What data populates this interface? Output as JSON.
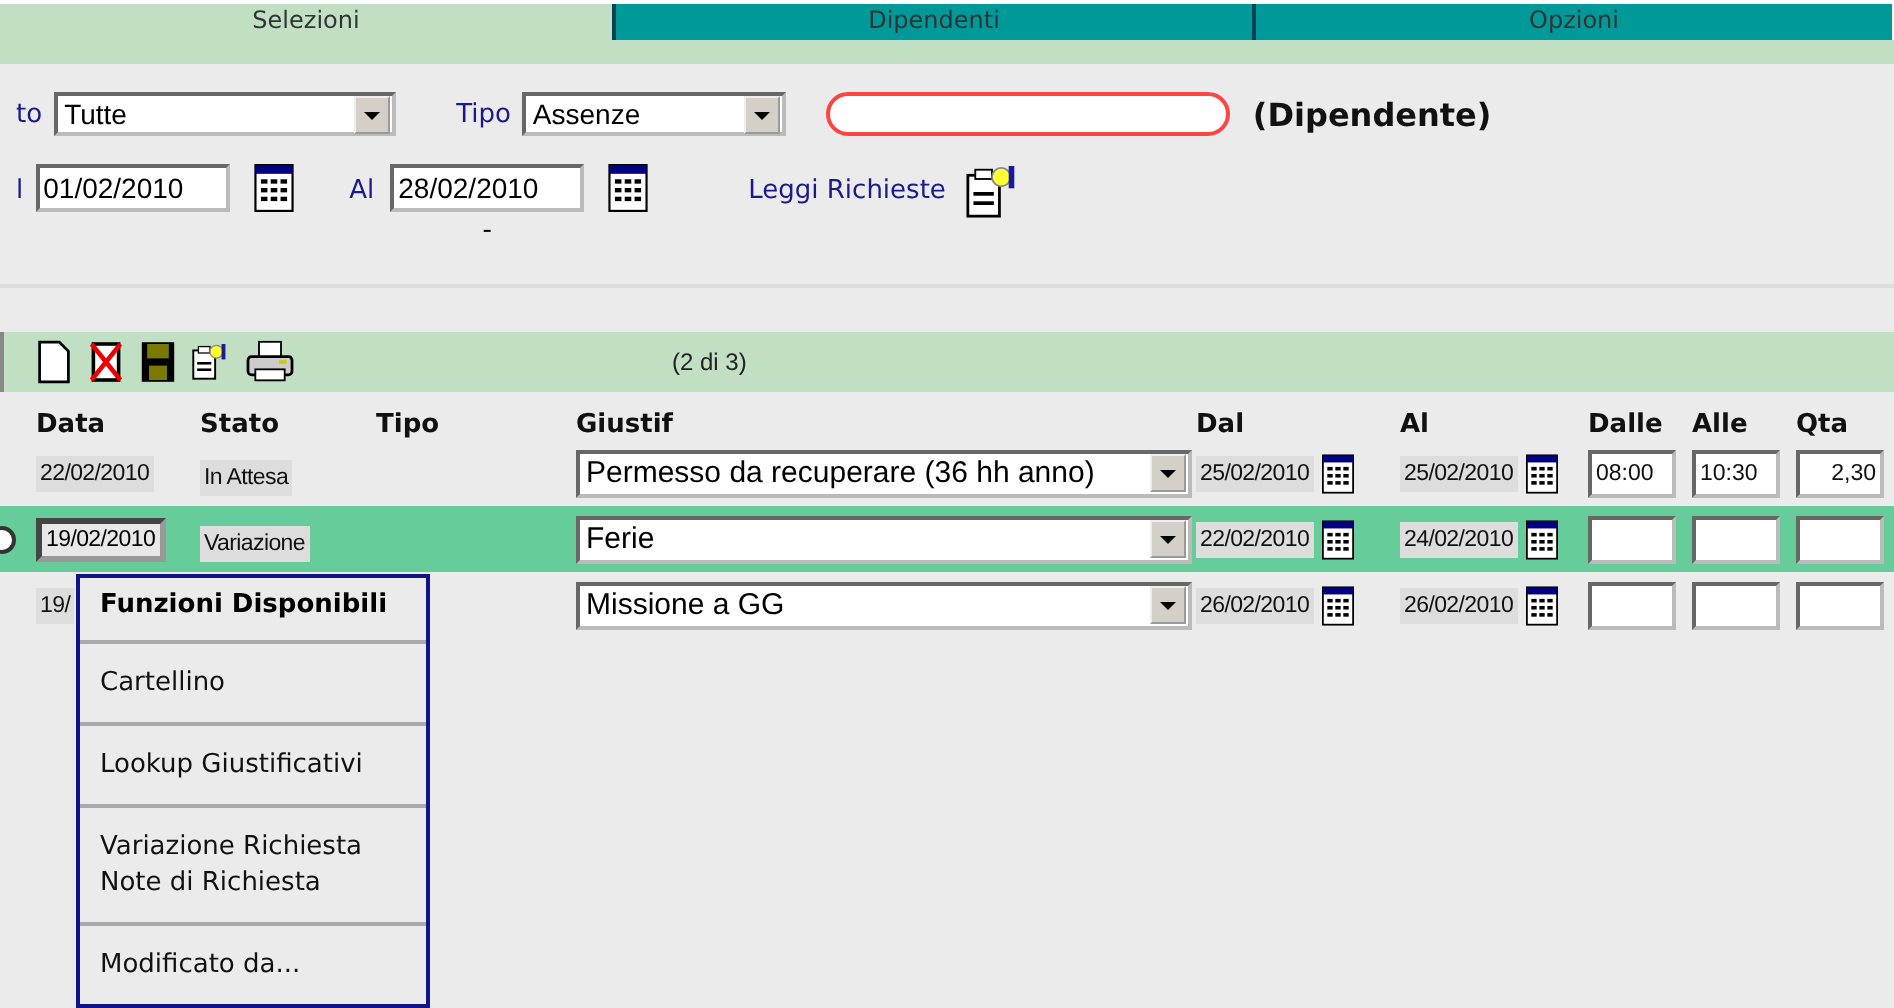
{
  "tabs": [
    {
      "label": "Selezioni",
      "selected": true
    },
    {
      "label": "Dipendenti",
      "selected": false
    },
    {
      "label": "Opzioni",
      "selected": false
    }
  ],
  "filters": {
    "stato_label": "to",
    "stato_value": "Tutte",
    "tipo_label": "Tipo",
    "tipo_value": "Assenze",
    "employee_label": "(Dipendente)",
    "dal_label": "l",
    "dal_value": "01/02/2010",
    "al_label": "Al",
    "al_value": "28/02/2010",
    "read_link": "Leggi Richieste",
    "dash": "-"
  },
  "toolbar": {
    "counter": "(2 di 3)"
  },
  "columns": [
    "Data",
    "Stato",
    "Tipo",
    "Giustif",
    "Dal",
    "Al",
    "Dalle",
    "Alle",
    "Qta"
  ],
  "rows": [
    {
      "selected": false,
      "data": "22/02/2010",
      "stato": "In Attesa",
      "giustif": "Permesso da recuperare (36 hh anno)",
      "dal": "25/02/2010",
      "al": "25/02/2010",
      "dalle": "08:00",
      "alle": "10:30",
      "qta": "2,30"
    },
    {
      "selected": true,
      "data": "19/02/2010",
      "stato": "Variazione",
      "giustif": "Ferie",
      "dal": "22/02/2010",
      "al": "24/02/2010"
    },
    {
      "selected": false,
      "data": "19/",
      "giustif": "Missione a GG",
      "dal": "26/02/2010",
      "al": "26/02/2010"
    }
  ],
  "context_menu": {
    "title": "Funzioni Disponibili",
    "items": [
      {
        "lines": [
          "Cartellino"
        ]
      },
      {
        "lines": [
          "Lookup Giustificativi"
        ]
      },
      {
        "lines": [
          "Variazione Richiesta",
          "Note di Richiesta"
        ]
      },
      {
        "lines": [
          "Modificato da..."
        ]
      }
    ]
  }
}
